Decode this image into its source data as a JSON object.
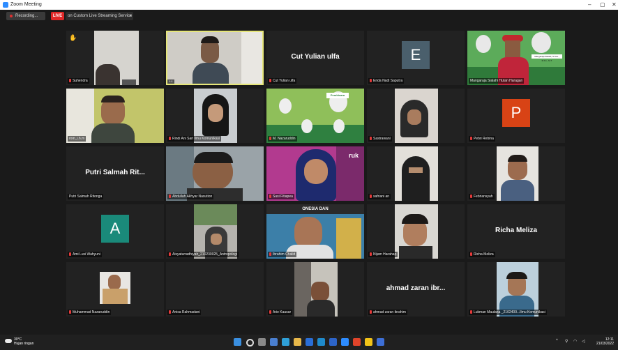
{
  "window": {
    "title": "Zoom Meeting",
    "controls": [
      "–",
      "▢",
      "✕"
    ]
  },
  "toolbar": {
    "recording_label": "Recording...",
    "live_badge": "LIVE",
    "live_service": "on Custom Live Streaming Service",
    "caret": "▾"
  },
  "tiles": [
    {
      "name": "Suhendra",
      "big": ""
    },
    {
      "name": "",
      "big": ""
    },
    {
      "name": "Cut Yulian ulfa",
      "big": "Cut Yulian ulfa"
    },
    {
      "name": "Enda Nadi Saputra",
      "big": "",
      "avatar": "E"
    },
    {
      "name": "Mangaraja Sialahi Hutan Haragan",
      "big": ""
    },
    {
      "name": "rom_i.h.m",
      "big": ""
    },
    {
      "name": "Rindi Ani Sari Ilmu Komunikasi",
      "big": ""
    },
    {
      "name": "M. Nazaruddin",
      "big": ""
    },
    {
      "name": "Sastrawani",
      "big": ""
    },
    {
      "name": "Pebri Rebina",
      "big": "",
      "avatar": "P"
    },
    {
      "name": "Putri Salmah Ritonga",
      "big": "Putri Salmah Rit..."
    },
    {
      "name": "Abdullah Akhyar Nasution",
      "big": ""
    },
    {
      "name": "Susi Fitiapea",
      "big": ""
    },
    {
      "name": "safriani an",
      "big": ""
    },
    {
      "name": "Febriansyah",
      "big": ""
    },
    {
      "name": "Ami Lusi Wahyuni",
      "big": "",
      "avatar": "A"
    },
    {
      "name": "Aisyaturradhiyah_210230025_Antropologi",
      "big": ""
    },
    {
      "name": "Ibrahim Chalid",
      "big": ""
    },
    {
      "name": "Nijam Harahap",
      "big": ""
    },
    {
      "name": "Richa Meliza",
      "big": "Richa Meliza"
    },
    {
      "name": "Muhammad Nazaruddin",
      "big": ""
    },
    {
      "name": "Anisa Rahmadani",
      "big": ""
    },
    {
      "name": "Arie Kausar",
      "big": ""
    },
    {
      "name": "ahmad zaran ibrahim",
      "big": "ahmad zaran ibr..."
    },
    {
      "name": "Lukman Maulana _2102400...Ilmu Komunikasi",
      "big": ""
    }
  ],
  "overlays": {
    "tile4_top": "Mangaraja Sialahi, S.Sos., M.Kn., M.T",
    "tile8_label": "Pembicara",
    "tile13_text": "ruk",
    "tile18_text": "ONESIA DAN",
    "tile2_badge": "1:1"
  },
  "taskbar": {
    "temp": "30°C",
    "condition": "Hujan ringan",
    "time": "12:11",
    "date": "21/03/2022"
  },
  "colors": {
    "accent": "#2d8cff",
    "live": "#e02828",
    "active_border": "#e6e67a",
    "avatar_teal": "#1a8a7a",
    "avatar_orange": "#d84315",
    "avatar_slate": "#4a5f6c"
  }
}
